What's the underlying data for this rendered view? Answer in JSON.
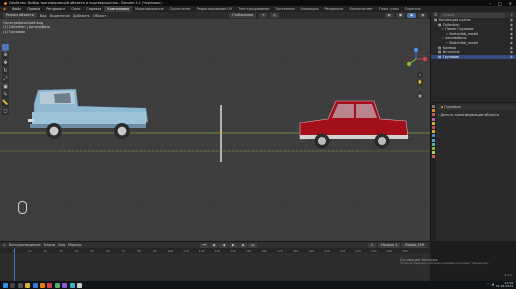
{
  "window": {
    "title": "Свойство: Выбор трансформаций объекта и подтверждения - Blender 4.1 (Черновик)"
  },
  "menu": {
    "items": [
      "Файл",
      "Правка",
      "Рендеринг",
      "Окно",
      "Справка"
    ],
    "workspaces": [
      "Компоновка",
      "Моделирование",
      "Скульптинг",
      "Редактирование UV",
      "Текстурирование",
      "Затенение",
      "Анимация",
      "Рендеринг",
      "Композитинг",
      "Геом. узлы",
      "Скрипты"
    ],
    "active_workspace": "Компоновка"
  },
  "viewport_header": {
    "mode": "Режим объекта",
    "menus": [
      "Вид",
      "Выделение",
      "Добавить",
      "Объект"
    ],
    "orientation": "Глобальная"
  },
  "viewport": {
    "info_lines": [
      "Ортографический вид",
      "(1) Collection | Автомобиль",
      "(1) Грузовик"
    ]
  },
  "outliner": {
    "search_placeholder": "Поиск",
    "rows": [
      {
        "label": "Коллекция сцены",
        "indent": 0
      },
      {
        "label": "Collection",
        "indent": 1
      },
      {
        "label": "Пикап Грузовик",
        "indent": 2
      },
      {
        "label": "Sketchfab_model",
        "indent": 3
      },
      {
        "label": "Автомобиль",
        "indent": 2
      },
      {
        "label": "Sketchfab_model",
        "indent": 3
      },
      {
        "label": "Камера",
        "indent": 1
      },
      {
        "label": "Источник",
        "indent": 1
      },
      {
        "label": "Грузовик",
        "indent": 1
      }
    ],
    "selected_index": 8
  },
  "properties": {
    "object_name": "Грузовик",
    "section": "Дельта трансформации объекта"
  },
  "timeline": {
    "menus": [
      "Воспроизведение",
      "Ключи",
      "Вид",
      "Маркер"
    ],
    "current_frame": "1",
    "start_label": "Начало",
    "start": "1",
    "end_label": "Конец",
    "end": "250",
    "ruler_ticks": [
      "0",
      "10",
      "20",
      "30",
      "40",
      "50",
      "60",
      "70",
      "80",
      "90",
      "100",
      "110",
      "120",
      "130",
      "140",
      "150",
      "160",
      "170",
      "180",
      "190",
      "200",
      "210",
      "220",
      "230",
      "240",
      "250"
    ]
  },
  "activation": {
    "title": "Активация Windows",
    "subtitle": "Чтобы активировать Windows, перейдите в раздел \"Параметры\"."
  },
  "status_bar": {
    "version": "4.1.0"
  },
  "taskbar": {
    "time": "12:48",
    "date": "01.04.2024"
  },
  "colors": {
    "accent": "#4772b3",
    "viewport_bg": "#3d3d3d",
    "truck_body": "#8fb8d1",
    "car_body": "#a4101a",
    "x_axis": "#8ab531"
  }
}
